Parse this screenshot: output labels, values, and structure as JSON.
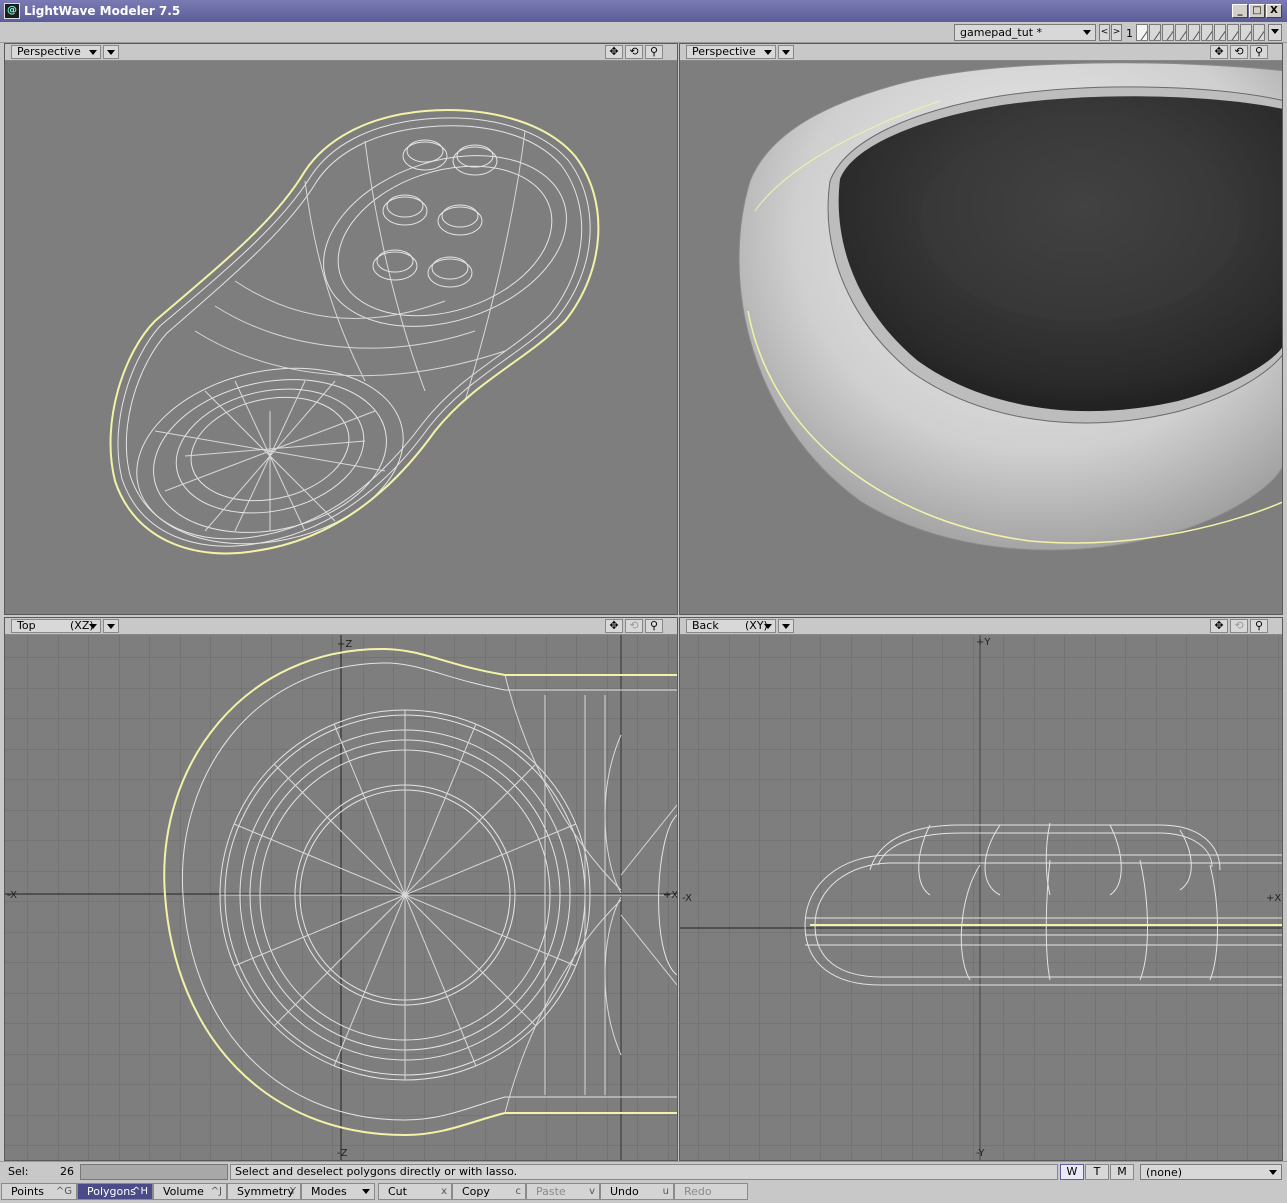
{
  "window": {
    "title": "LightWave Modeler 7.5",
    "minimize": "_",
    "maximize": "□",
    "close": "X"
  },
  "topbar": {
    "object_name": "gamepad_tut *",
    "prev": "<",
    "next": ">",
    "layer_number": "1"
  },
  "viewports": [
    {
      "view": "Perspective",
      "axis": ""
    },
    {
      "view": "Perspective",
      "axis": ""
    },
    {
      "view": "Top",
      "axis": "(XZ)",
      "labels": {
        "top": "+Z",
        "bottom": "-Z",
        "left": "-X",
        "right": "+X"
      }
    },
    {
      "view": "Back",
      "axis": "(XY)",
      "labels": {
        "top": "+Y",
        "bottom": "-Y",
        "left": "-X",
        "right": "+X"
      }
    }
  ],
  "controls": {
    "move": "✥",
    "rotate": "⟲",
    "zoom": "⚲"
  },
  "status": {
    "sel_label": "Sel:",
    "sel_count": "26",
    "help": "Select and deselect polygons directly or with lasso.",
    "w": "W",
    "t": "T",
    "m": "M",
    "vmap": "(none)"
  },
  "toolbar": {
    "points": {
      "label": "Points",
      "key": "^G"
    },
    "polygons": {
      "label": "Polygons",
      "key": "^H"
    },
    "volume": {
      "label": "Volume",
      "key": "^J"
    },
    "symmetry": {
      "label": "Symmetry",
      "key": "Y"
    },
    "modes": {
      "label": "Modes"
    },
    "cut": {
      "label": "Cut",
      "key": "x"
    },
    "copy": {
      "label": "Copy",
      "key": "c"
    },
    "paste": {
      "label": "Paste",
      "key": "v"
    },
    "undo": {
      "label": "Undo",
      "key": "u"
    },
    "redo": {
      "label": "Redo"
    }
  }
}
